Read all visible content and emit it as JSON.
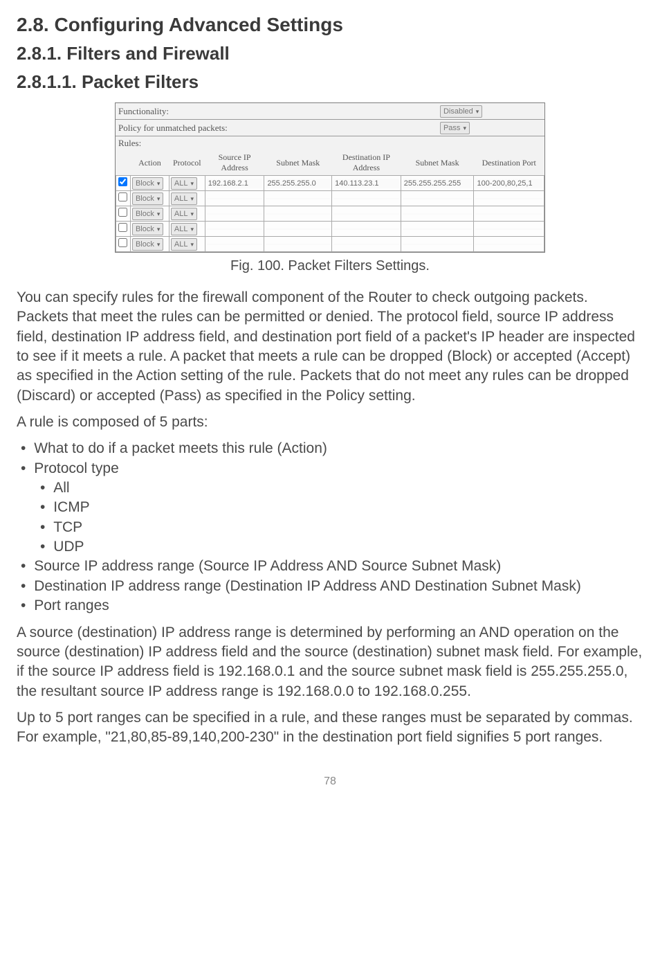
{
  "headings": {
    "h2": "2.8. Configuring Advanced Settings",
    "h3": "2.8.1. Filters and Firewall",
    "h4": "2.8.1.1. Packet Filters"
  },
  "figure": {
    "functionality_label": "Functionality:",
    "functionality_value": "Disabled",
    "policy_label": "Policy for unmatched packets:",
    "policy_value": "Pass",
    "rules_label": "Rules:",
    "headers": {
      "action": "Action",
      "protocol": "Protocol",
      "source_ip": "Source IP Address",
      "subnet_mask1": "Subnet Mask",
      "dest_ip": "Destination IP Address",
      "subnet_mask2": "Subnet Mask",
      "dest_port": "Destination Port"
    },
    "row1": {
      "checked": true,
      "action": "Block",
      "protocol": "ALL",
      "source_ip": "192.168.2.1",
      "subnet_mask1": "255.255.255.0",
      "dest_ip": "140.113.23.1",
      "subnet_mask2": "255.255.255.255",
      "dest_port": "100-200,80,25,1"
    },
    "empty_row": {
      "action": "Block",
      "protocol": "ALL"
    },
    "caption": "Fig. 100. Packet Filters Settings."
  },
  "paragraphs": {
    "p1": "You can specify rules for the firewall component of the Router to check outgoing packets. Packets that meet the rules can be permitted or denied. The protocol field, source IP address field, destination IP address field, and destination port field of a packet's IP header are inspected to see if it meets a rule. A packet that meets a rule can be dropped (Block) or accepted (Accept) as specified in the Action setting of the rule. Packets that do not meet any rules can be dropped (Discard) or accepted (Pass) as specified in the Policy setting.",
    "p2": "A rule is composed of 5 parts:",
    "p3": "A source (destination) IP address range is determined by performing an AND operation on the source (destination) IP address field and the source (destination) subnet mask field. For example, if the source IP address field is 192.168.0.1 and the source subnet mask field is 255.255.255.0, the resultant source IP address range is 192.168.0.0 to 192.168.0.255.",
    "p4": "Up to 5 port ranges can be specified in a rule, and these ranges must be separated by commas. For example, \"21,80,85-89,140,200-230\" in the destination port field signifies 5 port ranges."
  },
  "list": {
    "i1": "What to do if a packet meets this rule (Action)",
    "i2": "Protocol type",
    "i2a": "All",
    "i2b": "ICMP",
    "i2c": "TCP",
    "i2d": "UDP",
    "i3": "Source IP address range (Source IP Address AND Source Subnet Mask)",
    "i4": "Destination IP address range (Destination IP Address AND Destination Subnet Mask)",
    "i5": "Port ranges"
  },
  "page_number": "78"
}
